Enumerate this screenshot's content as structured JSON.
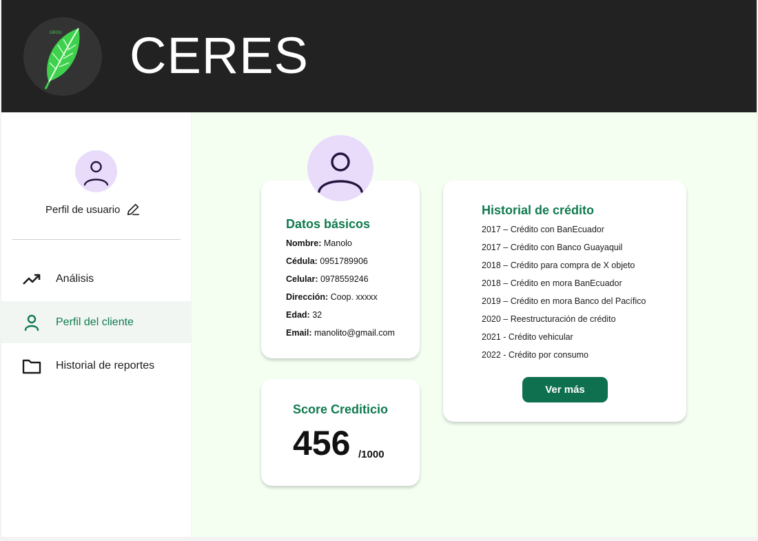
{
  "header": {
    "brand": "CERES",
    "logo_icon": "leaf-logo-icon",
    "logo_tagline": "GROU"
  },
  "sidebar": {
    "profile_label": "Perfil de usuario",
    "items": [
      {
        "label": "Análisis",
        "icon": "trending-up-icon",
        "active": false
      },
      {
        "label": "Perfil del cliente",
        "icon": "user-icon",
        "active": true
      },
      {
        "label": "Historial de reportes",
        "icon": "folder-icon",
        "active": false
      }
    ]
  },
  "basic_data": {
    "title": "Datos básicos",
    "fields": [
      {
        "label": "Nombre:",
        "value": " Manolo"
      },
      {
        "label": "Cédula:",
        "value": "0951789906"
      },
      {
        "label": "Celular:",
        "value": "0978559246"
      },
      {
        "label": "Dirección:",
        "value": "Coop. xxxxx"
      },
      {
        "label": "Edad:",
        "value": "32"
      },
      {
        "label": "Email:",
        "value": "manolito@gmail.com"
      }
    ]
  },
  "score": {
    "title": "Score Crediticio",
    "value": "456",
    "max": "/1000"
  },
  "history": {
    "title": "Historial de crédito",
    "items": [
      "2017 – Crédito con BanEcuador",
      "2017 – Crédito con Banco Guayaquil",
      "2018 – Crédito para compra de X objeto",
      "2018 – Crédito en mora BanEcuador",
      "2019 – Crédito en mora Banco del Pacífico",
      "2020 – Reestructuración de crédito",
      "2021 - Crédito vehicular",
      "2022 - Crédito por consumo"
    ],
    "button_label": "Ver más"
  },
  "colors": {
    "accent": "#0f7a4e",
    "header_bg": "#222222",
    "avatar_bg": "#e9dcfb",
    "main_bg": "#f4fff2"
  }
}
